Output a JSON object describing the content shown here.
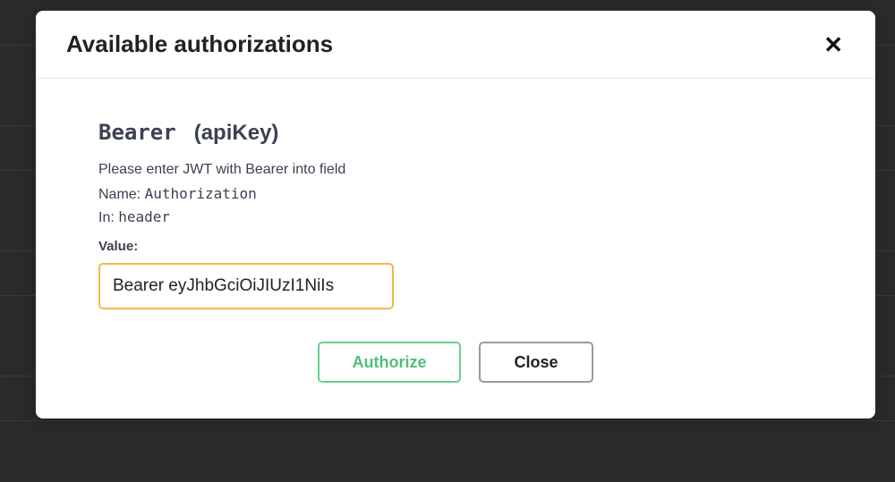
{
  "modal": {
    "title": "Available authorizations",
    "close_glyph": "✕"
  },
  "auth": {
    "scheme_name": "Bearer",
    "scheme_type": "(apiKey)",
    "description": "Please enter JWT with Bearer into field",
    "name_label": "Name: ",
    "name_value": "Authorization",
    "in_label": "In: ",
    "in_value": "header",
    "value_label": "Value:",
    "value_input": "Bearer eyJhbGciOiJIUzI1NiIs"
  },
  "buttons": {
    "authorize": "Authorize",
    "close": "Close"
  }
}
